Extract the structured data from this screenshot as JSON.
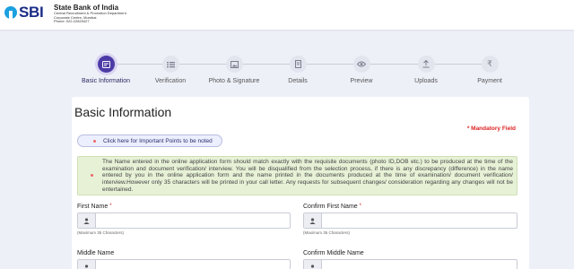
{
  "header": {
    "logo_text": "SBI",
    "bank_name": "State Bank of India",
    "dept_lines": [
      "Central Recruitment & Promotion Department",
      "Corporate Centre, Mumbai",
      "Phone: 022-22820427"
    ]
  },
  "stepper": {
    "steps": [
      {
        "label": "Basic Information",
        "icon": "id-card-icon",
        "active": true
      },
      {
        "label": "Verification",
        "icon": "checklist-icon",
        "active": false
      },
      {
        "label": "Photo & Signature",
        "icon": "image-icon",
        "active": false
      },
      {
        "label": "Details",
        "icon": "document-icon",
        "active": false
      },
      {
        "label": "Preview",
        "icon": "eye-icon",
        "active": false
      },
      {
        "label": "Uploads",
        "icon": "upload-icon",
        "active": false
      },
      {
        "label": "Payment",
        "icon": "rupee-icon",
        "active": false
      }
    ]
  },
  "form": {
    "title": "Basic Information",
    "mandatory_note": "* Mandatory Field",
    "important_points_label": "Click here for Important Points to be noted",
    "notice": "The Name entered in the online application form should match exactly with the requisite documents (photo ID,DOB etc.) to be produced at the time of the examination and document verification/ interview. You will be disqualified from the selection process, if there is any discrepancy (difference) in the name entered by you in the online application form and the name printed in the documents produced at the time of examination/ document verification/ interview.However only 35 characters will be printed in your call letter. Any requests for subsequent changes/ consideration regarding any changes will not be entertained.",
    "fields": {
      "first_name": {
        "label": "First Name",
        "required": "*",
        "value": "",
        "hint": "(Maximum 35 Characters)"
      },
      "confirm_first_name": {
        "label": "Confirm First Name",
        "required": "*",
        "value": "",
        "hint": "(Maximum 35 Characters)"
      },
      "middle_name": {
        "label": "Middle Name",
        "value": ""
      },
      "confirm_middle_name": {
        "label": "Confirm Middle Name",
        "value": ""
      }
    }
  },
  "colors": {
    "accent": "#4c3ba6",
    "brand": "#1b2c86",
    "required": "#dd2222",
    "notice_bg": "#e6f1d6"
  }
}
